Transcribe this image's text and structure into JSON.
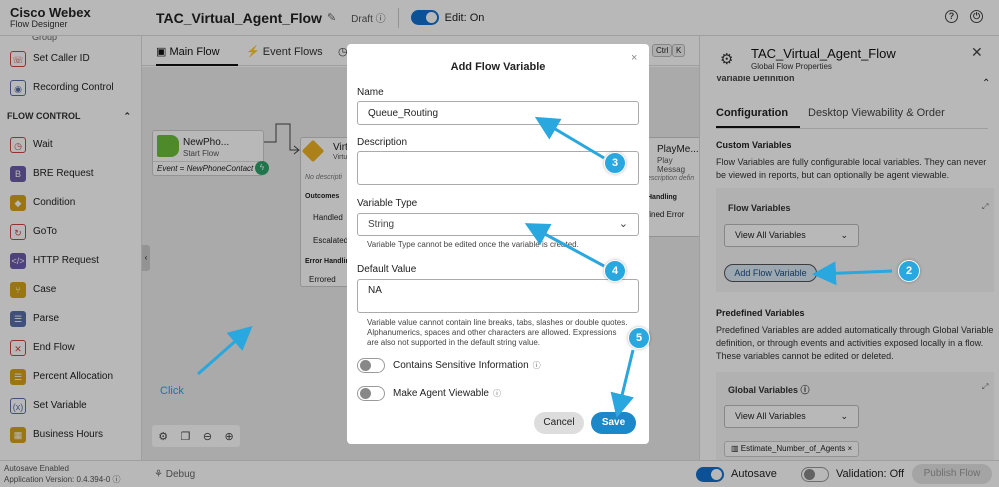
{
  "app": {
    "brand": "Cisco Webex",
    "product": "Flow Designer",
    "flow_name": "TAC_Virtual_Agent_Flow",
    "status": "Draft",
    "edit_label": "Edit: On"
  },
  "tabs": {
    "main_flow": "Main Flow",
    "event_flows": "Event Flows",
    "kbd_ctrl": "Ctrl",
    "kbd_k": "K"
  },
  "palette": {
    "partial_top": "Group",
    "items_top": [
      {
        "label": "Set Caller ID",
        "icon": "phone-icon"
      },
      {
        "label": "Recording Control",
        "icon": "record-icon"
      }
    ],
    "section": "FLOW CONTROL",
    "items": [
      {
        "label": "Wait",
        "icon": "clock-icon"
      },
      {
        "label": "BRE Request",
        "icon": "bre-icon"
      },
      {
        "label": "Condition",
        "icon": "condition-icon"
      },
      {
        "label": "GoTo",
        "icon": "goto-icon"
      },
      {
        "label": "HTTP Request",
        "icon": "http-icon"
      },
      {
        "label": "Case",
        "icon": "case-icon"
      },
      {
        "label": "Parse",
        "icon": "parse-icon"
      },
      {
        "label": "End Flow",
        "icon": "end-flow-icon"
      },
      {
        "label": "Percent Allocation",
        "icon": "percent-icon"
      },
      {
        "label": "Set Variable",
        "icon": "variable-icon"
      },
      {
        "label": "Business Hours",
        "icon": "calendar-icon"
      }
    ],
    "autosave_status": "Autosave Enabled",
    "app_version": "Application Version: 0.4.394-0"
  },
  "canvas": {
    "start_node": {
      "title": "NewPho...",
      "subtitle": "Start Flow",
      "event": "Event = NewPhoneContact"
    },
    "virtual_node": {
      "title": "Virt",
      "subtitle": "Virtu",
      "desc": "No descripti",
      "outcomes": "Outcomes",
      "handled": "Handled",
      "escalated": "Escalated",
      "error_handling": "Error Handlin",
      "errored": "Errored"
    },
    "play_node": {
      "title": "PlayMe...",
      "subtitle": "Play Messag",
      "desc": "escription defin",
      "handling": "Handling",
      "error": "fined Error"
    },
    "click_label": "Click"
  },
  "right_panel": {
    "title": "TAC_Virtual_Agent_Flow",
    "subtitle": "Global Flow Properties",
    "section_partial": "Variable Definition",
    "tab_config": "Configuration",
    "tab_desktop": "Desktop Viewability & Order",
    "custom_heading": "Custom Variables",
    "custom_desc": "Flow Variables are fully configurable local variables. They can never be viewed in reports, but can optionally be agent viewable.",
    "flow_vars_label": "Flow Variables",
    "view_all": "View All Variables",
    "add_flow_var": "Add Flow Variable",
    "predef_heading": "Predefined Variables",
    "predef_desc": "Predefined Variables are added automatically through Global Variable definition, or through events and activities exposed locally in a flow. These variables cannot be edited or deleted.",
    "global_vars_label": "Global Variables",
    "view_all_2": "View All Variables",
    "chip": "Estimate_Number_of_Agents"
  },
  "bottom": {
    "debug": "Debug",
    "autosave": "Autosave",
    "validation": "Validation: Off",
    "publish": "Publish Flow"
  },
  "modal": {
    "title": "Add Flow Variable",
    "name_label": "Name",
    "name_value": "Queue_Routing",
    "description_label": "Description",
    "description_value": "",
    "type_label": "Variable Type",
    "type_value": "String",
    "type_hint": "Variable Type cannot be edited once the variable is created.",
    "default_label": "Default Value",
    "default_value": "NA",
    "default_hint": "Variable value cannot contain line breaks, tabs, slashes or double quotes. Alphanumerics, spaces and other characters are allowed. Expressions are also not supported in the default string value.",
    "sensitive_label": "Contains Sensitive Information",
    "agent_viewable_label": "Make Agent Viewable",
    "cancel": "Cancel",
    "save": "Save"
  },
  "annotations": {
    "step2": "2",
    "step3": "3",
    "step4": "4",
    "step5": "5"
  },
  "colors": {
    "accent": "#1170cf",
    "save_button": "#1a88c9",
    "annotation": "#29a7df",
    "start_node": "#6cbf3a",
    "virtual_node": "#f0b323"
  }
}
